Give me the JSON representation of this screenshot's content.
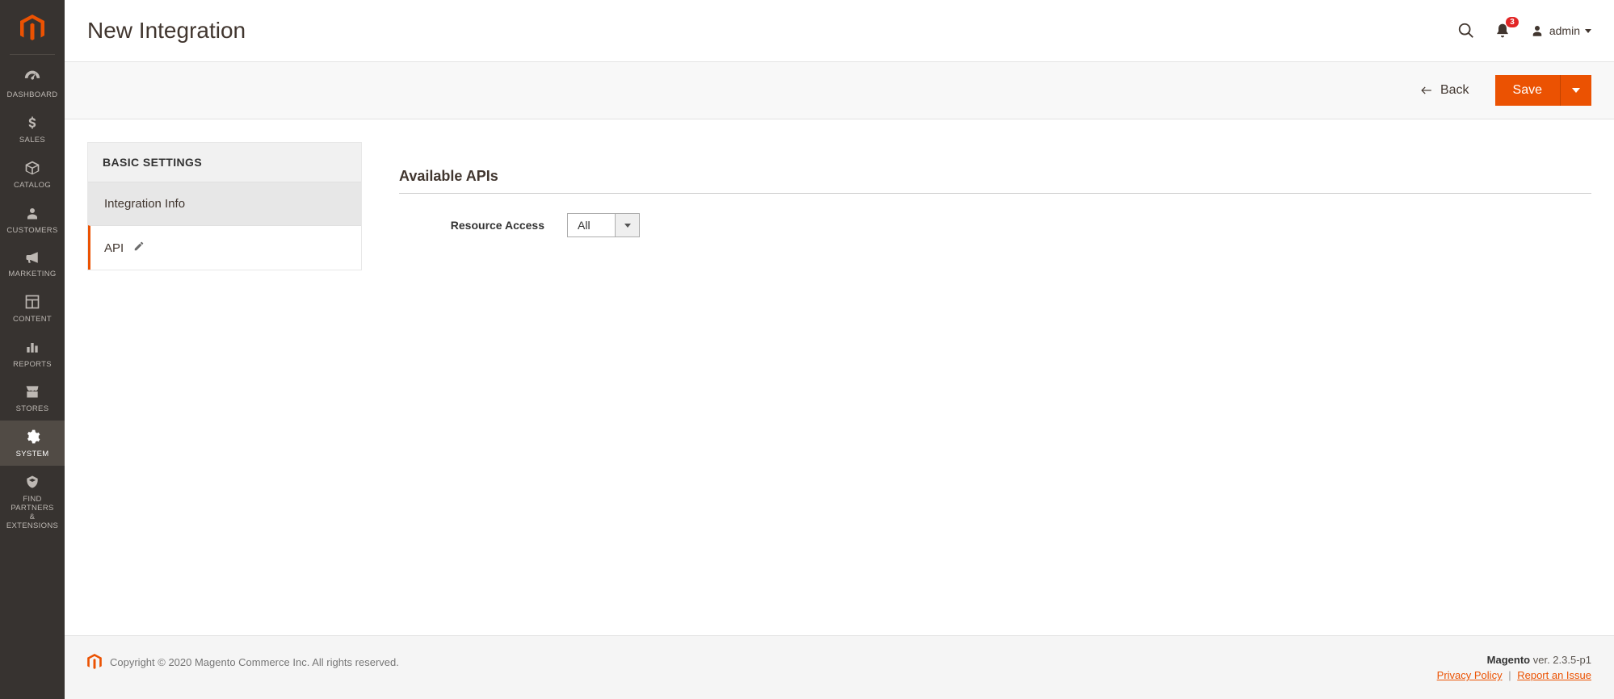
{
  "sidebar": {
    "items": [
      {
        "id": "dashboard",
        "label": "DASHBOARD"
      },
      {
        "id": "sales",
        "label": "SALES"
      },
      {
        "id": "catalog",
        "label": "CATALOG"
      },
      {
        "id": "customers",
        "label": "CUSTOMERS"
      },
      {
        "id": "marketing",
        "label": "MARKETING"
      },
      {
        "id": "content",
        "label": "CONTENT"
      },
      {
        "id": "reports",
        "label": "REPORTS"
      },
      {
        "id": "stores",
        "label": "STORES"
      },
      {
        "id": "system",
        "label": "SYSTEM"
      },
      {
        "id": "partners",
        "label": "FIND PARTNERS\n& EXTENSIONS"
      }
    ]
  },
  "header": {
    "page_title": "New Integration",
    "notification_count": "3",
    "username": "admin"
  },
  "toolbar": {
    "back_label": "Back",
    "save_label": "Save"
  },
  "settings": {
    "title": "BASIC SETTINGS",
    "items": [
      {
        "label": "Integration Info",
        "active": false
      },
      {
        "label": "API",
        "active": true
      }
    ]
  },
  "form": {
    "section_title": "Available APIs",
    "resource_access_label": "Resource Access",
    "resource_access_value": "All"
  },
  "footer": {
    "copyright": "Copyright © 2020 Magento Commerce Inc. All rights reserved.",
    "product": "Magento",
    "version_prefix": " ver. ",
    "version": "2.3.5-p1",
    "privacy_label": "Privacy Policy",
    "report_label": "Report an Issue"
  }
}
